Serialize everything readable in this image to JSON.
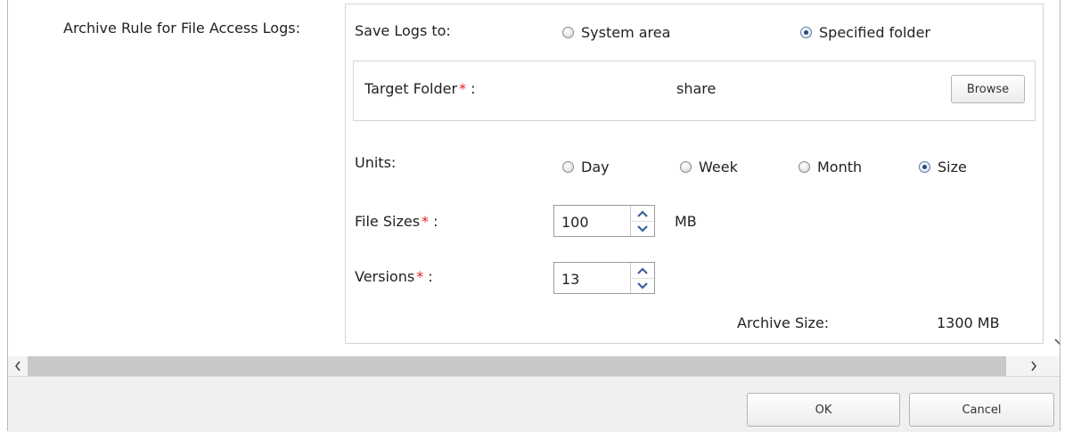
{
  "settings": {
    "archive_rule_label": "Archive Rule for File Access Logs:",
    "save_logs_to_label": "Save Logs to:",
    "save_logs_options": [
      {
        "label": "System area",
        "checked": false
      },
      {
        "label": "Specified folder",
        "checked": true
      }
    ],
    "target_folder_label": "Target Folder",
    "target_folder_value": "share",
    "browse_label": "Browse",
    "units_label": "Units:",
    "units_options": [
      {
        "label": "Day",
        "checked": false
      },
      {
        "label": "Week",
        "checked": false
      },
      {
        "label": "Month",
        "checked": false
      },
      {
        "label": "Size",
        "checked": true
      }
    ],
    "file_sizes_label": "File Sizes",
    "file_sizes_value": "100",
    "file_sizes_unit": "MB",
    "versions_label": "Versions",
    "versions_value": "13",
    "archive_size_label": "Archive Size:",
    "archive_size_value": "1300 MB",
    "required_mark": "*",
    "colon": ":"
  },
  "footer": {
    "ok_label": "OK",
    "cancel_label": "Cancel"
  },
  "icons": {
    "scroll_left": "chevron-left-icon",
    "scroll_right": "chevron-right-icon",
    "scroll_down": "chevron-down-icon",
    "spin_up": "chevron-up-icon",
    "spin_down": "chevron-down-icon"
  },
  "colors": {
    "required": "#e02020",
    "spin_arrow": "#3a5f9a",
    "radio_selected": "#2b4a78"
  }
}
